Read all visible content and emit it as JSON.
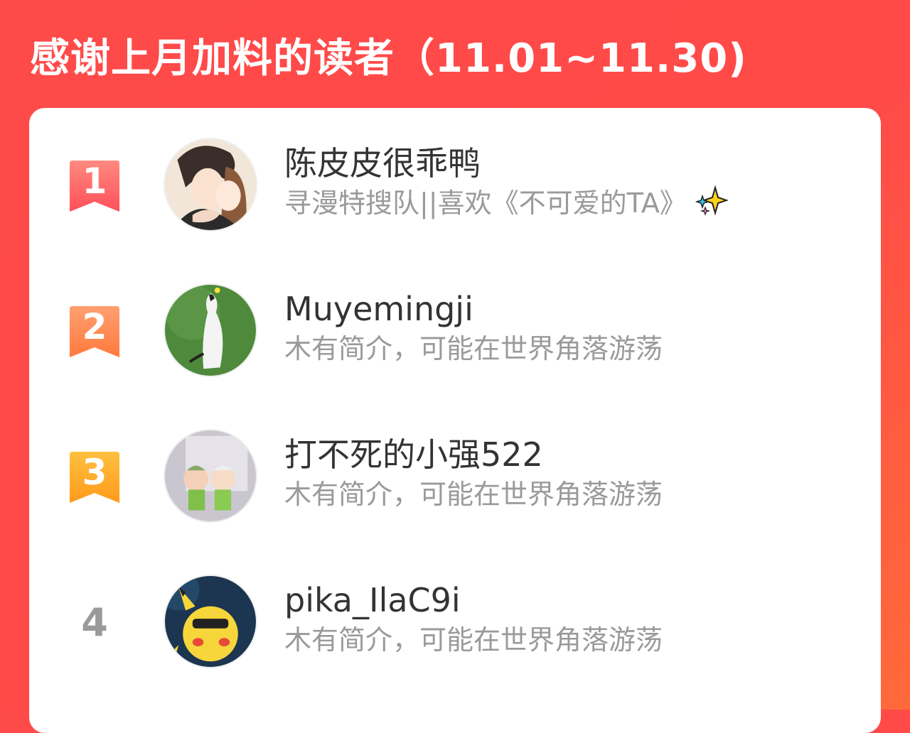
{
  "header": {
    "title": "感谢上月加料的读者（11.01~11.30)"
  },
  "readers": [
    {
      "rank": "1",
      "name": "陈皮皮很乖鸭",
      "bio": "寻漫特搜队||喜欢《不可爱的TA》",
      "bio_icon": "sparkles-icon",
      "badge_color": "#ff5a5f"
    },
    {
      "rank": "2",
      "name": "Muyemingji",
      "bio": "木有简介，可能在世界角落游荡",
      "badge_color": "#ff8040"
    },
    {
      "rank": "3",
      "name": "打不死的小强522",
      "bio": "木有简介，可能在世界角落游荡",
      "badge_color": "#ffa020"
    },
    {
      "rank": "4",
      "name": "pika_IlaC9i",
      "bio": "木有简介，可能在世界角落游荡"
    }
  ],
  "colors": {
    "background": "#ff4a4a",
    "card": "#ffffff",
    "name_text": "#333333",
    "bio_text": "#9a9a9a"
  }
}
